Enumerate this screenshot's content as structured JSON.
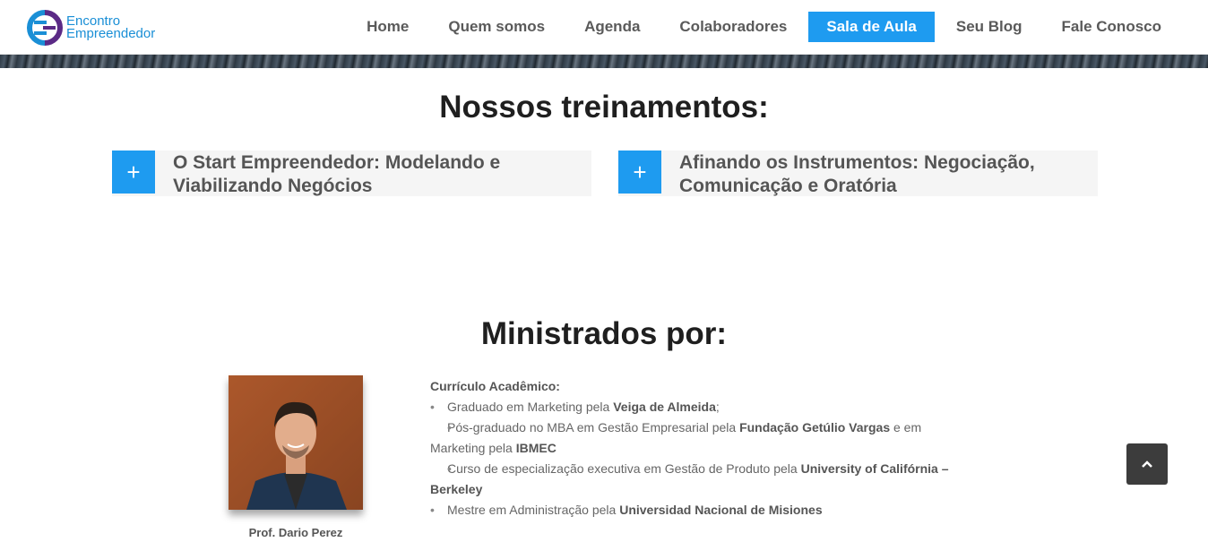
{
  "header": {
    "logo_line1": "Encontro",
    "logo_line2": "Empreendedor",
    "nav": [
      "Home",
      "Quem somos",
      "Agenda",
      "Colaboradores",
      "Sala de Aula",
      "Seu Blog",
      "Fale Conosco"
    ],
    "active_item": "Sala de Aula"
  },
  "trainings": {
    "title": "Nossos treinamentos:",
    "items": [
      {
        "line1": "O Start Empreendedor: Modelando e",
        "line2": "Viabilizando Negócios"
      },
      {
        "line1": "Afinando os Instrumentos: Negociação,",
        "line2": "Comunicação e Oratória"
      }
    ],
    "expand_symbol": "+"
  },
  "instructor": {
    "title": "Ministrados por:",
    "name": "Prof. Dario Perez",
    "cv_heading": "Currículo Acadêmico:",
    "cv": [
      {
        "text": "Graduado em Marketing pela ",
        "bold": "Veiga de Almeida",
        "after": ";"
      },
      {
        "text": "Pós-graduado no MBA em Gestão Empresarial pela ",
        "bold": "Fundação Getúlio Vargas",
        "after": " e em Marketing pela ",
        "bold2": "IBMEC"
      },
      {
        "text": "Curso de especialização executiva em Gestão de Produto pela ",
        "bold": "University of Califórnia – Berkeley",
        "after": ""
      },
      {
        "text": "Mestre em Administração pela ",
        "bold": "Universidad Nacional de Misiones",
        "after": ""
      }
    ]
  },
  "colors": {
    "accent": "#1e9bf0",
    "logo_purple": "#5b2a86",
    "logo_blue": "#1a8fd6"
  },
  "icons": {
    "scroll_top": "chevron-up-icon",
    "expand": "plus-icon"
  }
}
